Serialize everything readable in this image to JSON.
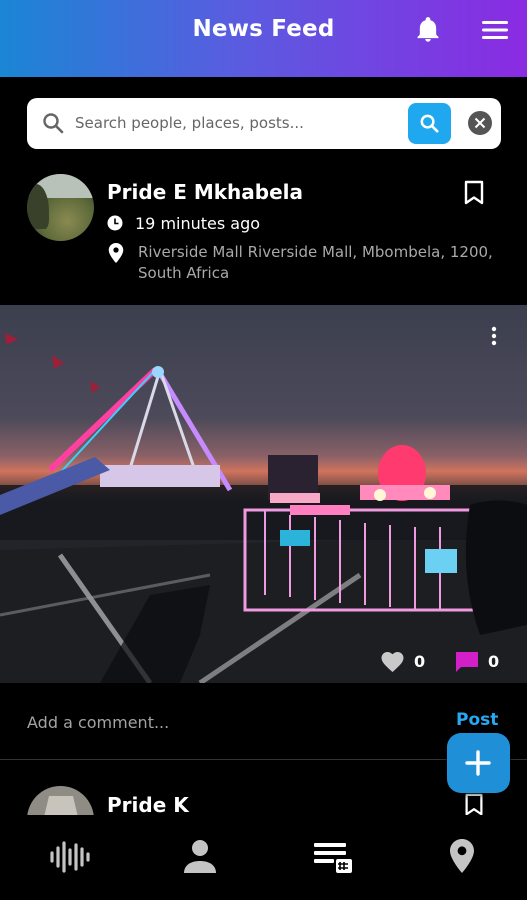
{
  "header": {
    "title": "News Feed",
    "icons": [
      "bell-icon",
      "menu-icon"
    ],
    "gradient": [
      "#1a86d4",
      "#8a2be2"
    ]
  },
  "search": {
    "placeholder": "Search people, places, posts...",
    "value": "",
    "button_color": "#1fa8f0"
  },
  "post": {
    "author": "Pride E Mkhabela",
    "time": "19 minutes ago",
    "location": "Riverside Mall  Riverside Mall, Mbombela, 1200, South Africa",
    "likes": "0",
    "comments": "0",
    "comment_placeholder": "Add a comment...",
    "post_label": "Post"
  },
  "next_post": {
    "author": "Pride K"
  },
  "bottom_nav": {
    "items": [
      "feed-wave-icon",
      "profile-icon",
      "news-icon",
      "location-icon"
    ]
  },
  "colors": {
    "accent": "#27a8f2",
    "comment_icon": "#d31fc8",
    "background": "#000000"
  }
}
